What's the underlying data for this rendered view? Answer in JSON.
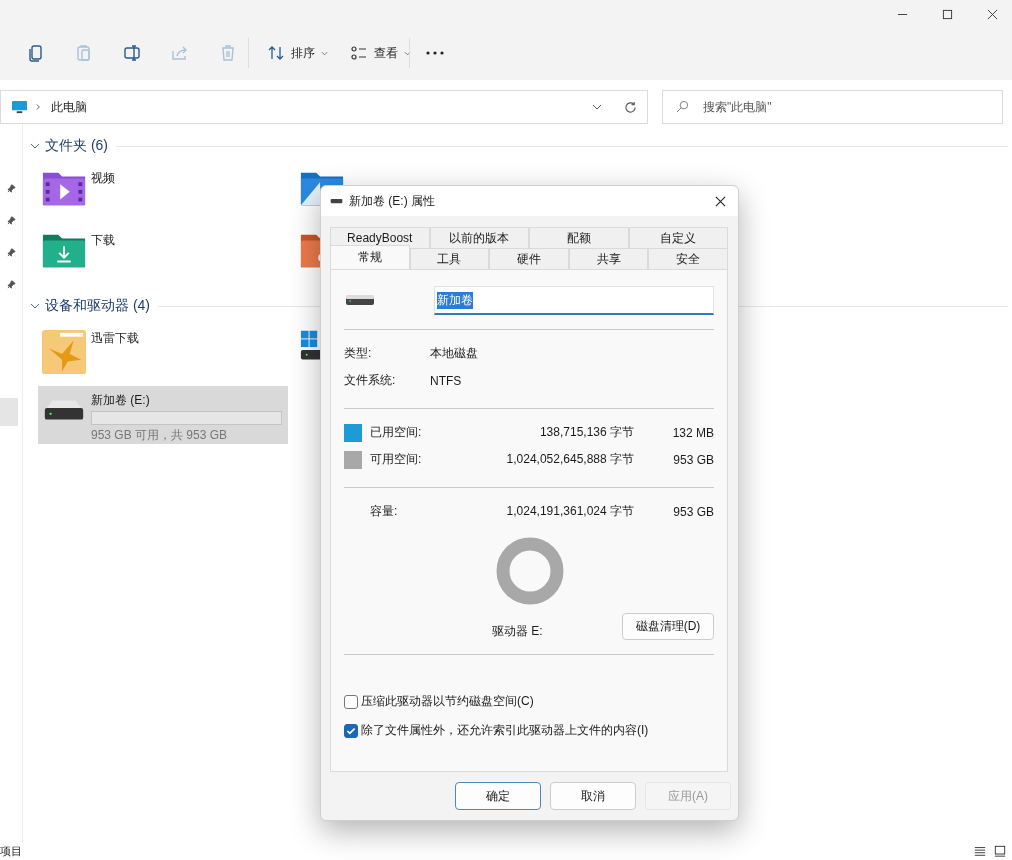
{
  "toolbar": {
    "buttons": [
      {
        "kind": "copy",
        "disabled": false
      },
      {
        "kind": "paste",
        "disabled": true
      },
      {
        "kind": "rename",
        "disabled": false
      },
      {
        "kind": "share",
        "disabled": true
      },
      {
        "kind": "delete",
        "disabled": true
      }
    ],
    "sort": "排序",
    "view": "查看"
  },
  "address": {
    "path": "此电脑"
  },
  "search": {
    "placeholder": "搜索\"此电脑\""
  },
  "nav": [
    {
      "pinned": true,
      "selected": false
    },
    {
      "pinned": true,
      "selected": false
    },
    {
      "pinned": true,
      "selected": false
    },
    {
      "pinned": true,
      "selected": false
    },
    {
      "pinned": false,
      "selected": true
    }
  ],
  "sections": [
    {
      "title": "文件夹 (6)",
      "expanded": true,
      "items": [
        {
          "kind": "video",
          "name": "视频"
        },
        {
          "kind": "pictures"
        },
        {
          "kind": "download",
          "name": "下载"
        },
        {
          "kind": "music"
        }
      ]
    },
    {
      "title": "设备和驱动器 (4)",
      "expanded": true,
      "items": [
        {
          "kind": "xunlei",
          "name": "迅雷下载"
        },
        {
          "kind": "system"
        },
        {
          "kind": "drive",
          "name": "新加卷 (E:)",
          "level": 0,
          "caption": "953 GB 可用，共 953 GB",
          "selected": true
        }
      ]
    }
  ],
  "status_bar": {
    "text": "项目"
  },
  "dialog": {
    "title": "新加卷 (E:) 属性",
    "tab_rows": [
      [
        {
          "label": "ReadyBoost",
          "selected": false
        },
        {
          "label": "以前的版本",
          "selected": false
        },
        {
          "label": "配额",
          "selected": false
        },
        {
          "label": "自定义",
          "selected": false
        }
      ],
      [
        {
          "label": "常规",
          "selected": true
        },
        {
          "label": "工具",
          "selected": false
        },
        {
          "label": "硬件",
          "selected": false
        },
        {
          "label": "共享",
          "selected": false
        },
        {
          "label": "安全",
          "selected": false
        }
      ]
    ],
    "name_field": {
      "value": "新加卷",
      "text_selected": true
    },
    "info": [
      {
        "label": "类型:",
        "value": "本地磁盘"
      },
      {
        "label": "文件系统:",
        "value": "NTFS"
      }
    ],
    "space": [
      {
        "label": "已用空间:",
        "bytes": "138,715,136 字节",
        "size": "132 MB",
        "color": "#1e9ad6"
      },
      {
        "label": "可用空间:",
        "bytes": "1,024,052,645,888 字节",
        "size": "953 GB",
        "color": "#a8a8a8"
      }
    ],
    "capacity": {
      "label": "容量:",
      "bytes": "1,024,191,361,024 字节",
      "size": "953 GB"
    },
    "drive_label": "驱动器 E:",
    "cleanup_button": "磁盘清理(D)",
    "options": [
      {
        "label": "压缩此驱动器以节约磁盘空间(C)",
        "checked": false
      },
      {
        "label": "除了文件属性外，还允许索引此驱动器上文件的内容(I)",
        "checked": true
      }
    ],
    "buttons": [
      {
        "label": "确定",
        "kind": "default",
        "disabled": false
      },
      {
        "label": "取消",
        "kind": "normal",
        "disabled": false
      },
      {
        "label": "应用(A)",
        "kind": "normal",
        "disabled": true
      }
    ]
  }
}
